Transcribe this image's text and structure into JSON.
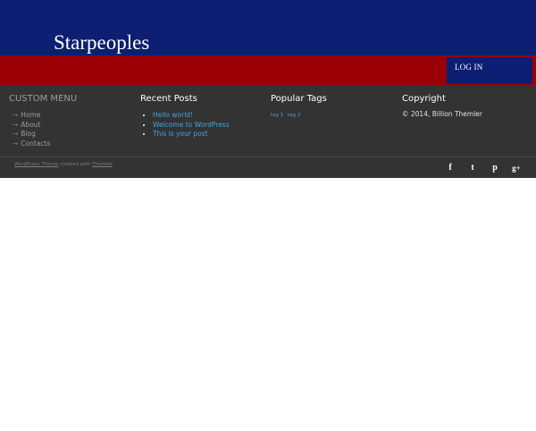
{
  "header": {
    "site_title": "Starpeoples"
  },
  "topbar": {
    "login_label": "LOG IN"
  },
  "footer": {
    "menu": {
      "title": "CUSTOM MENU",
      "items": [
        "Home",
        "About",
        "Blog",
        "Contacts"
      ],
      "arrow": "→"
    },
    "recent_posts": {
      "title": "Recent Posts",
      "items": [
        "Hello world!",
        "Welcome to WordPress",
        "This is your post"
      ]
    },
    "popular_tags": {
      "title": "Popular Tags",
      "tags": [
        "tag 1",
        "tag 2"
      ]
    },
    "copyright": {
      "title": "Copyright",
      "text": "© 2014, Billion Themler"
    },
    "credit": {
      "link1": "WordPress Theme",
      "middle": " created with ",
      "link2": "Themler",
      "end": "."
    },
    "social": {
      "facebook": "f",
      "tumblr": "t",
      "pinterest": "p",
      "googleplus": "g+"
    }
  },
  "colors": {
    "header": "#0d1f73",
    "bar": "#9a0005",
    "footer": "#333333",
    "link": "#3ea6e0"
  }
}
